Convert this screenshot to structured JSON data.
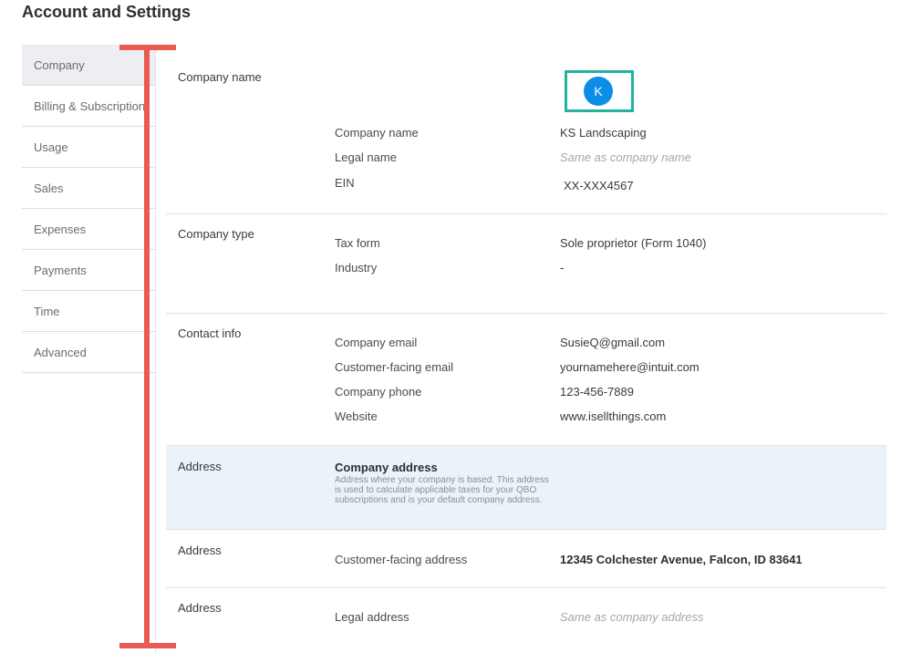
{
  "page": {
    "title": "Account and Settings"
  },
  "sidebar": {
    "items": [
      {
        "label": "Company"
      },
      {
        "label": "Billing & Subscription"
      },
      {
        "label": "Usage"
      },
      {
        "label": "Sales"
      },
      {
        "label": "Expenses"
      },
      {
        "label": "Payments"
      },
      {
        "label": "Time"
      },
      {
        "label": "Advanced"
      }
    ]
  },
  "company_name_section": {
    "title": "Company name",
    "avatar_initial": "K",
    "rows": [
      {
        "label": "Company name",
        "value": "KS Landscaping"
      },
      {
        "label": "Legal name",
        "value": "Same as company name"
      },
      {
        "label": "EIN",
        "value": "XX-XXX4567"
      }
    ]
  },
  "company_type_section": {
    "title": "Company type",
    "rows": [
      {
        "label": "Tax form",
        "value": "Sole proprietor (Form 1040)"
      },
      {
        "label": "Industry",
        "value": "-"
      }
    ]
  },
  "contact_section": {
    "title": "Contact info",
    "rows": [
      {
        "label": "Company email",
        "value": "SusieQ@gmail.com"
      },
      {
        "label": "Customer-facing email",
        "value": "yournamehere@intuit.com"
      },
      {
        "label": "Company phone",
        "value": "123-456-7889"
      },
      {
        "label": "Website",
        "value": "www.isellthings.com"
      }
    ]
  },
  "address_section": {
    "title": "Address",
    "heading": "Company address",
    "description": "Address where your company is based. This address is used to calculate applicable taxes for your QBO subscriptions and is your default company address."
  },
  "customer_address_section": {
    "title": "Address",
    "label": "Customer-facing address",
    "value": "12345 Colchester Avenue, Falcon, ID 83641"
  },
  "legal_address_section": {
    "title": "Address",
    "label": "Legal address",
    "value": "Same as company address"
  },
  "colors": {
    "accent_bracket": "#e85a52",
    "avatar": "#0b8ee6",
    "avatar_frame": "#22b3a1",
    "highlight": "#eaf2fa"
  }
}
